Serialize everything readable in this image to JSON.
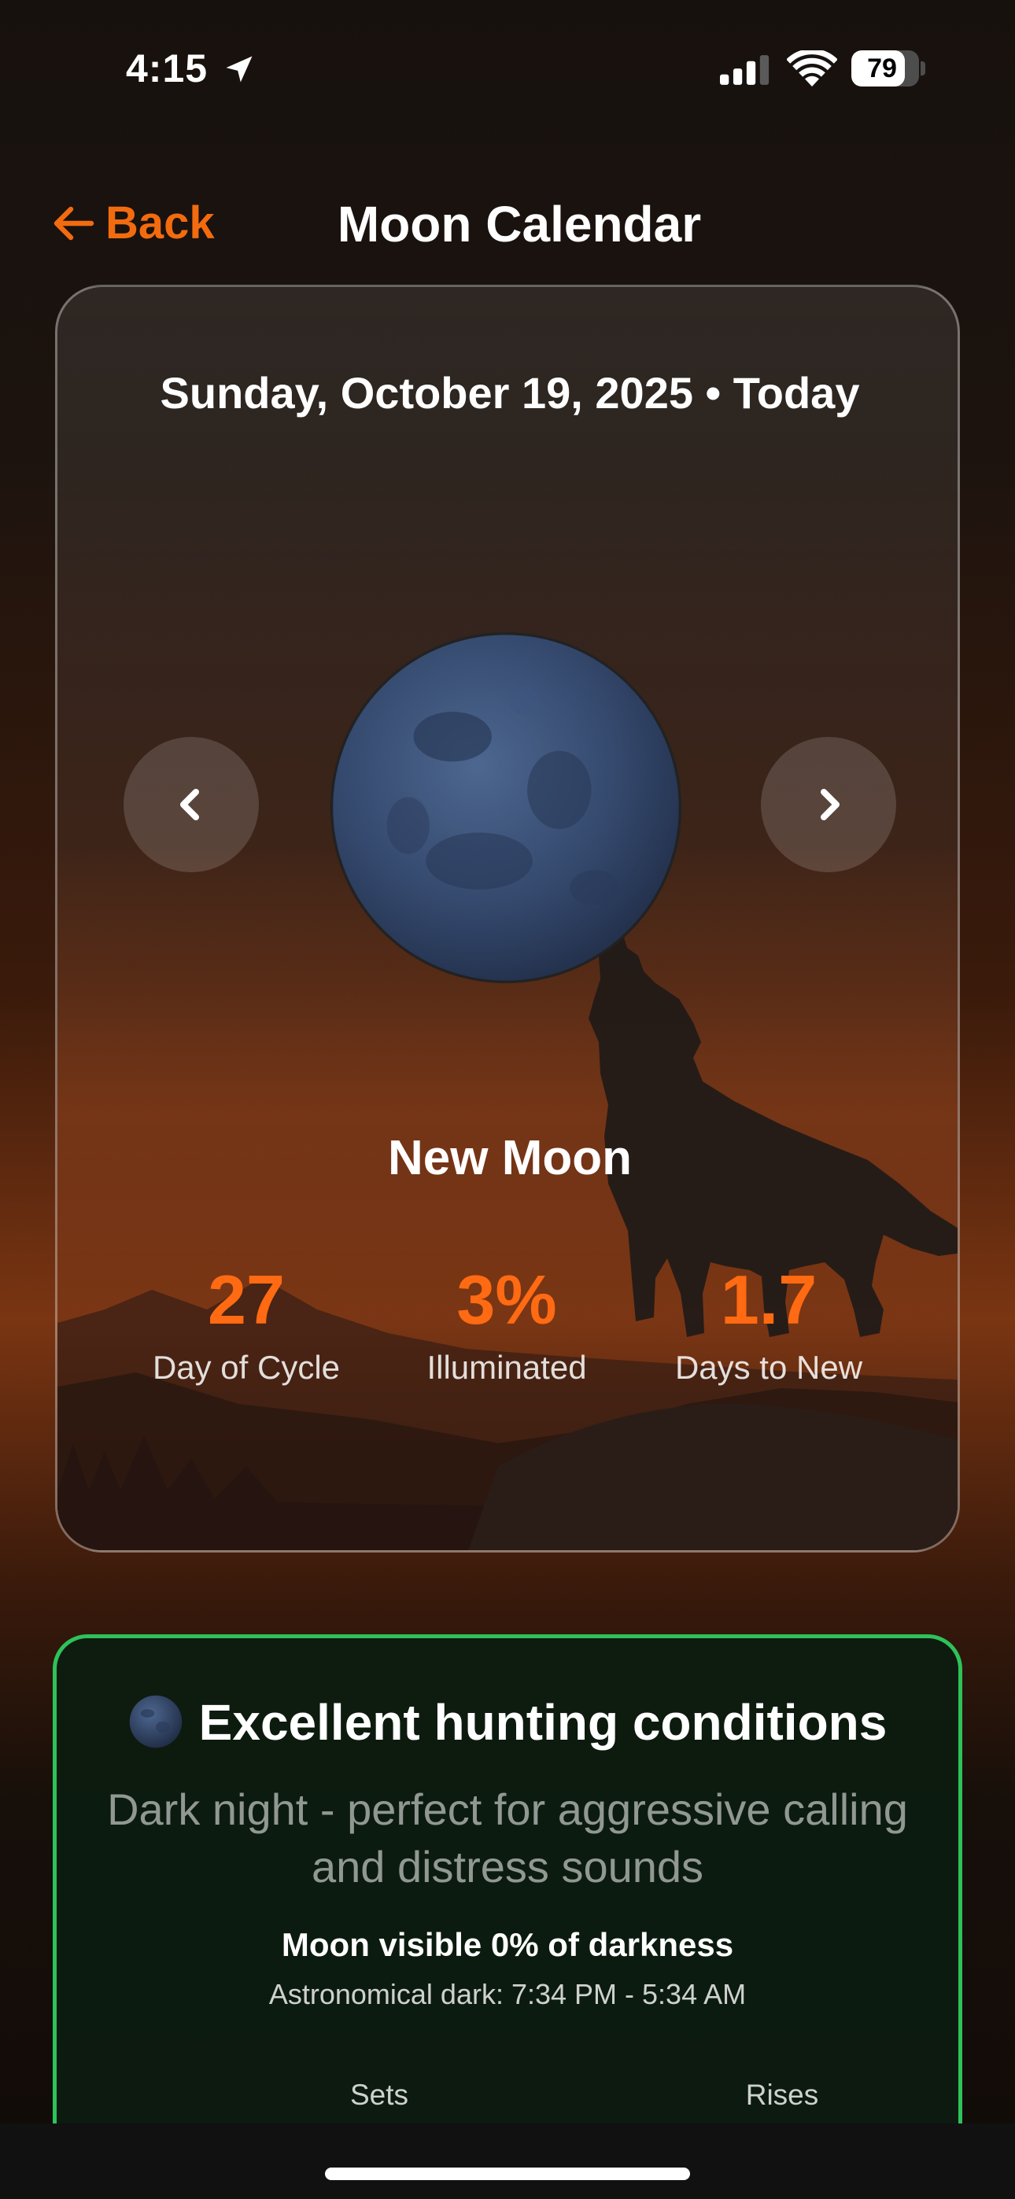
{
  "status_bar": {
    "time": "4:15",
    "battery": "79",
    "battery_level": 0.79,
    "icons": [
      "location-arrow-icon",
      "signal-icon",
      "wifi-icon",
      "battery-icon"
    ]
  },
  "nav": {
    "back_label": "Back",
    "title": "Moon Calendar"
  },
  "moon_card": {
    "date": "Sunday, October 19, 2025 • Today",
    "phase_name": "New Moon",
    "stats": [
      {
        "value": "27",
        "label": "Day of Cycle"
      },
      {
        "value": "3%",
        "label": "Illuminated"
      },
      {
        "value": "1.7",
        "label": "Days to New"
      }
    ]
  },
  "conditions": {
    "title": "Excellent hunting conditions",
    "description": "Dark night - perfect for aggressive calling and distress sounds",
    "visibility": "Moon visible 0% of darkness",
    "astronomical_dark": "Astronomical dark: 7:34 PM - 5:34 AM",
    "sets_label": "Sets",
    "rises_label": "Rises"
  },
  "colors": {
    "accent": "#f26b0f",
    "stat_value": "#ff6a12",
    "conditions_border": "#2ec25a",
    "moon": "#33476b"
  }
}
